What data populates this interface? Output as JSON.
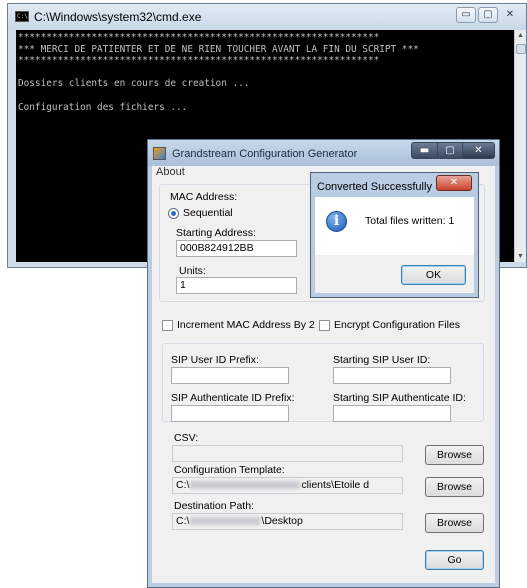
{
  "cmd": {
    "title": "C:\\Windows\\system32\\cmd.exe",
    "icon": "cmd-icon",
    "console_text": "****************************************************************\n*** MERCI DE PATIENTER ET DE NE RIEN TOUCHER AVANT LA FIN DU SCRIPT ***\n****************************************************************\n\nDossiers clients en cours de creation ...\n\nConfiguration des fichiers ...",
    "controls": {
      "minimize": "▭",
      "maximize": "▢",
      "close": "✕"
    }
  },
  "app": {
    "title": "Grandstream Configuration Generator",
    "menu": {
      "about": "About"
    },
    "controls": {
      "minimize": "▬",
      "maximize": "▢",
      "close": "✕"
    },
    "mac": {
      "group_label": "MAC Address:",
      "sequential_label": "Sequential",
      "starting_address_label": "Starting Address:",
      "starting_address_value": "000B824912BB",
      "units_label": "Units:",
      "units_value": "1"
    },
    "options": {
      "increment_label": "Increment MAC Address By 2",
      "encrypt_label": "Encrypt Configuration Files"
    },
    "sip": {
      "user_prefix_label": "SIP User ID Prefix:",
      "user_prefix_value": "",
      "start_user_label": "Starting SIP User ID:",
      "start_user_value": "",
      "auth_prefix_label": "SIP Authenticate ID Prefix:",
      "auth_prefix_value": "",
      "start_auth_label": "Starting SIP Authenticate ID:",
      "start_auth_value": ""
    },
    "csv": {
      "label": "CSV:",
      "value": "",
      "browse": "Browse"
    },
    "template": {
      "label": "Configuration Template:",
      "prefix": "C:\\",
      "suffix": "clients\\Etoile d",
      "browse": "Browse"
    },
    "destination": {
      "label": "Destination Path:",
      "prefix": "C:\\",
      "suffix": "\\Desktop",
      "browse": "Browse"
    },
    "go_label": "Go"
  },
  "dialog": {
    "title": "Converted Successfully",
    "close": "✕",
    "icon": "info-icon",
    "message": "Total files written: 1",
    "ok_label": "OK"
  }
}
